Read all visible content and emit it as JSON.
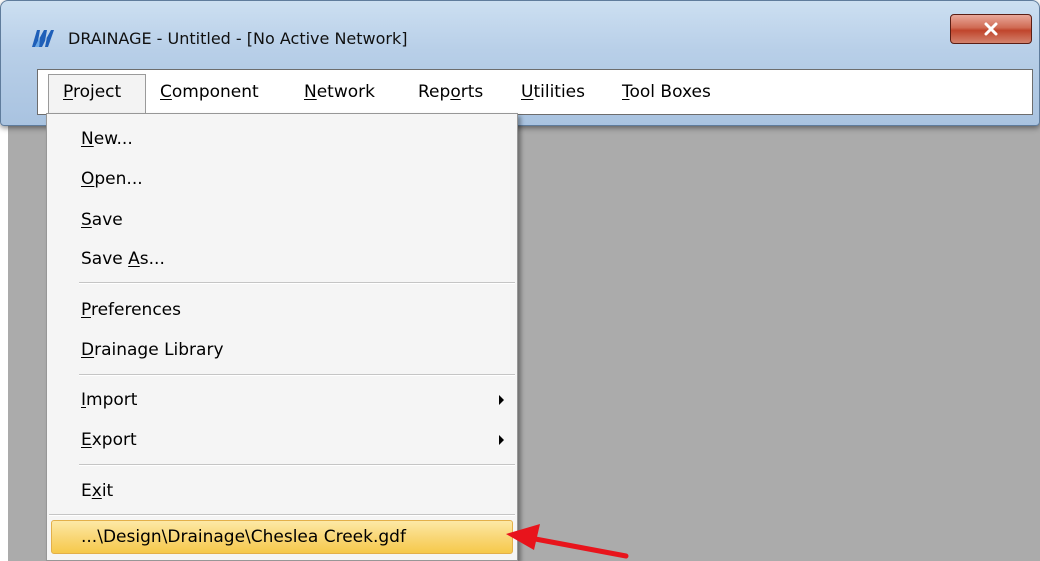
{
  "window": {
    "title": "DRAINAGE - Untitled - [No Active Network]",
    "close_glyph": "x"
  },
  "menubar": {
    "items": [
      {
        "pre": "",
        "key": "P",
        "post": "roject"
      },
      {
        "pre": "",
        "key": "C",
        "post": "omponent"
      },
      {
        "pre": "",
        "key": "N",
        "post": "etwork"
      },
      {
        "pre": "Rep",
        "key": "o",
        "post": "rts"
      },
      {
        "pre": "",
        "key": "U",
        "post": "tilities"
      },
      {
        "pre": "",
        "key": "T",
        "post": "ool Boxes"
      }
    ]
  },
  "dropdown": {
    "items": [
      {
        "pre": "",
        "key": "N",
        "post": "ew..."
      },
      {
        "pre": "",
        "key": "O",
        "post": "pen..."
      },
      {
        "pre": "",
        "key": "S",
        "post": "ave"
      },
      {
        "pre": "Save ",
        "key": "A",
        "post": "s..."
      },
      {
        "pre": "",
        "key": "P",
        "post": "references"
      },
      {
        "pre": "",
        "key": "D",
        "post": "rainage Library"
      },
      {
        "pre": "",
        "key": "I",
        "post": "mport"
      },
      {
        "pre": "",
        "key": "E",
        "post": "xport"
      },
      {
        "pre": "E",
        "key": "x",
        "post": "it"
      }
    ],
    "recent_file": "...\\Design\\Drainage\\Cheslea Creek.gdf"
  },
  "colors": {
    "highlight": "#f9d777",
    "annotation_arrow": "#e8141c",
    "close_button": "#c0452c"
  }
}
